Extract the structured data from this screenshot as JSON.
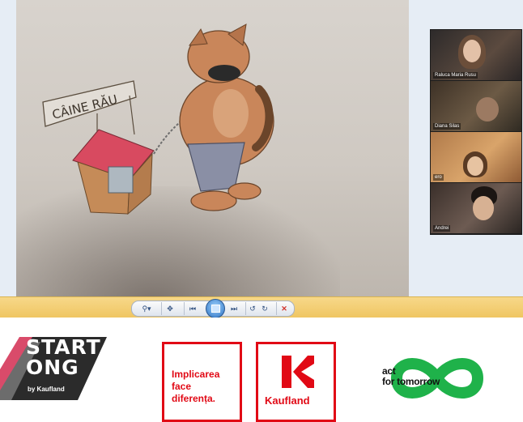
{
  "drawing": {
    "sign_text": "CÂINE RĂU"
  },
  "participants": [
    {
      "name": "Raluca Maria Rusu"
    },
    {
      "name": "Diana Silas"
    },
    {
      "name": "ero"
    },
    {
      "name": "Andrei"
    }
  ],
  "viewer_toolbar": {
    "zoom_icon": "magnifier-icon",
    "fit_icon": "fit-window-icon",
    "prev_icon": "previous-icon",
    "slideshow_icon": "slideshow-icon",
    "next_icon": "next-icon",
    "rotate_ccw_icon": "rotate-counterclockwise-icon",
    "rotate_cw_icon": "rotate-clockwise-icon",
    "delete_icon": "delete-icon"
  },
  "logos": {
    "startong": {
      "line1": "START",
      "line2": "ONG",
      "by": "by Kaufland"
    },
    "implicarea": {
      "line1": "Implicarea",
      "line2": "face",
      "line3": "diferența."
    },
    "kaufland": {
      "label": "Kaufland"
    },
    "act": {
      "line1": "act",
      "line2": "for tomorrow"
    }
  },
  "colors": {
    "kaufland_red": "#e10915",
    "toolbar_gold": "#efc561",
    "act_green": "#1fb24a"
  }
}
